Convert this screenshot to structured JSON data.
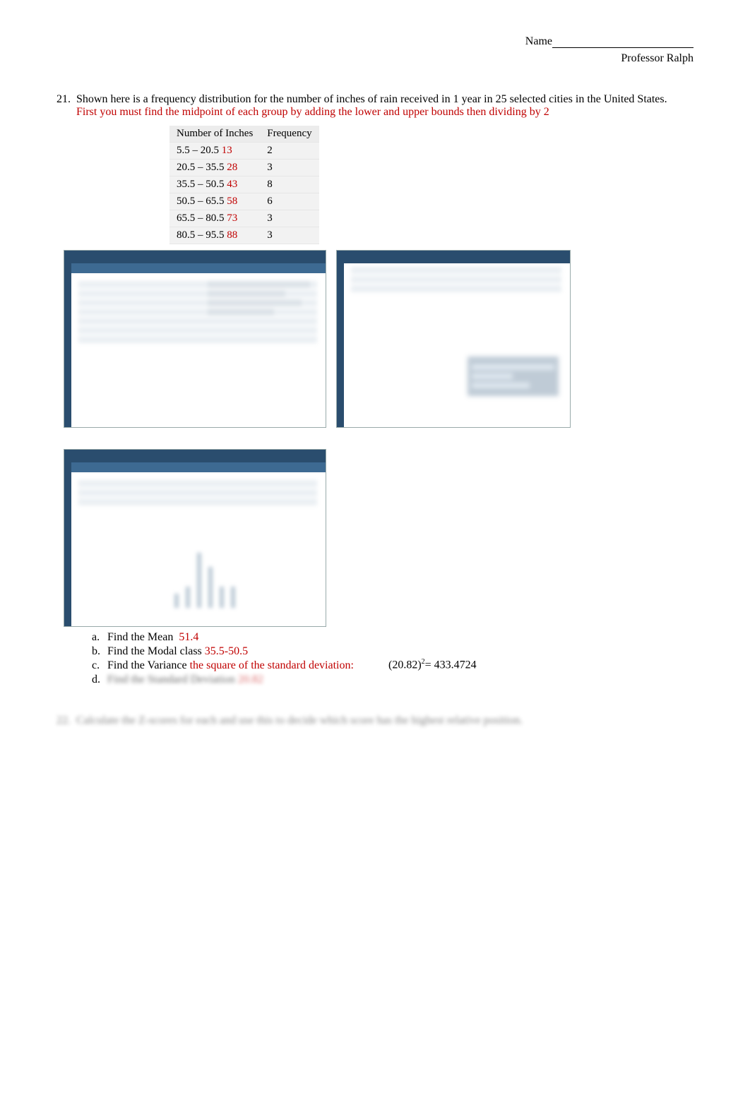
{
  "header": {
    "name_label": "Name",
    "professor": "Professor Ralph"
  },
  "question21": {
    "number": "21.",
    "text": "Shown here is a frequency distribution for the number of inches of rain received in 1 year in 25 selected cities in the United States.",
    "hint": "First you must find the midpoint of each group by adding the lower and upper bounds then dividing by 2",
    "table": {
      "header_range": "Number of Inches",
      "header_freq": "Frequency",
      "rows": [
        {
          "range": "5.5 – 20.5",
          "mid": "13",
          "freq": "2"
        },
        {
          "range": "20.5 – 35.5",
          "mid": "28",
          "freq": "3"
        },
        {
          "range": "35.5 – 50.5",
          "mid": "43",
          "freq": "8"
        },
        {
          "range": "50.5 – 65.5",
          "mid": "58",
          "freq": "6"
        },
        {
          "range": "65.5 – 80.5",
          "mid": "73",
          "freq": "3"
        },
        {
          "range": "80.5 – 95.5",
          "mid": "88",
          "freq": "3"
        }
      ]
    },
    "subparts": {
      "a": {
        "letter": "a.",
        "label": "Find the Mean",
        "answer": "51.4"
      },
      "b": {
        "letter": "b.",
        "label": "Find the Modal class",
        "answer": "35.5-50.5"
      },
      "c": {
        "letter": "c.",
        "label": "Find the Variance",
        "answer": "the square of the standard deviation:",
        "formula_left": "(20.82)",
        "formula_exp": "2",
        "formula_right": "= 433.4724"
      },
      "d": {
        "letter": "d.",
        "label_blur": "Find the Standard Deviation",
        "answer_blur": "20.82"
      }
    }
  },
  "question22": {
    "number": "22.",
    "text_blur": "Calculate the Z-scores for each and use this to decide which score has the highest relative position."
  }
}
